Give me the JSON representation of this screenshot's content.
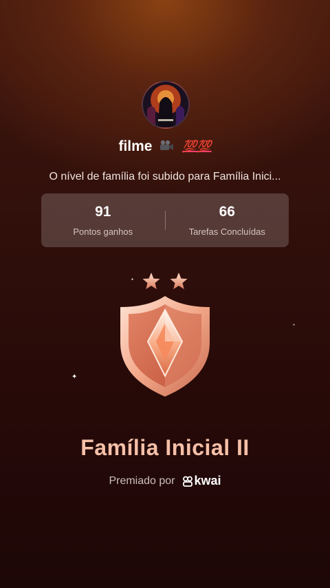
{
  "user": {
    "name": "filme",
    "name_emojis": "💯💯",
    "avatar_icon": "movie-poster-avatar"
  },
  "message": "O nível de família foi subido para Família Inici...",
  "stats": [
    {
      "value": "91",
      "label": "Pontos ganhos"
    },
    {
      "value": "66",
      "label": "Tarefas Concluídas"
    }
  ],
  "badge": {
    "stars": 2,
    "icon": "shield-diamond-badge-icon",
    "title": "Família Inicial II"
  },
  "footer": {
    "awarded_by": "Premiado por",
    "brand": "kwai"
  },
  "colors": {
    "accent": "#f6c0a8",
    "hundred": "#ff3f6e"
  }
}
